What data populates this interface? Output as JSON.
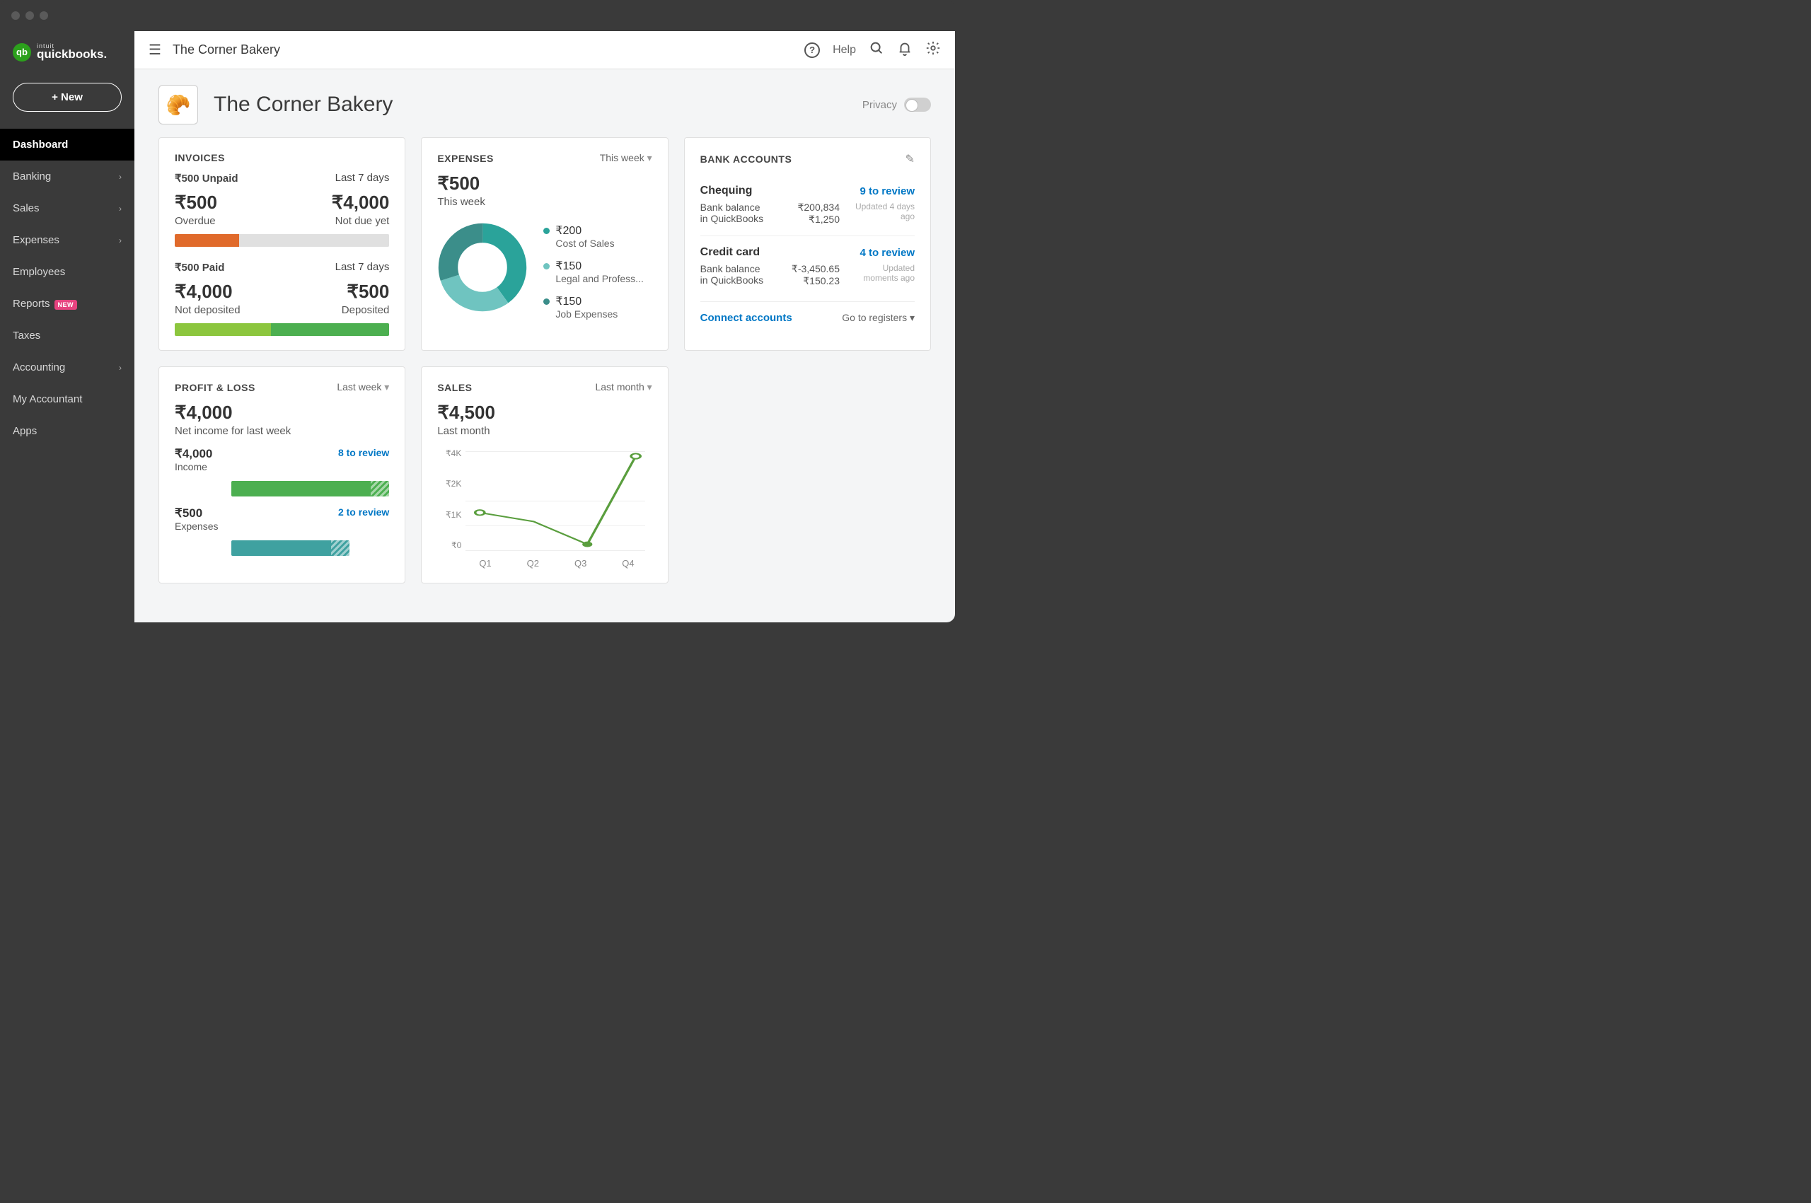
{
  "brand": {
    "badge": "qb",
    "top": "intuit",
    "name": "quickbooks."
  },
  "new_button": "+ New",
  "nav": [
    {
      "label": "Dashboard",
      "active": true,
      "chevron": false
    },
    {
      "label": "Banking",
      "chevron": true
    },
    {
      "label": "Sales",
      "chevron": true
    },
    {
      "label": "Expenses",
      "chevron": true
    },
    {
      "label": "Employees",
      "chevron": false
    },
    {
      "label": "Reports",
      "chevron": false,
      "badge": "NEW"
    },
    {
      "label": "Taxes",
      "chevron": false
    },
    {
      "label": "Accounting",
      "chevron": true
    },
    {
      "label": "My Accountant",
      "chevron": false
    },
    {
      "label": "Apps",
      "chevron": false
    }
  ],
  "topbar": {
    "title": "The Corner Bakery",
    "help": "Help"
  },
  "header": {
    "business_name": "The Corner Bakery",
    "privacy": "Privacy"
  },
  "invoices": {
    "title": "INVOICES",
    "unpaid_line": "₹500 Unpaid",
    "unpaid_period": "Last 7 days",
    "overdue_amt": "₹500",
    "overdue_lbl": "Overdue",
    "notdue_amt": "₹4,000",
    "notdue_lbl": "Not due yet",
    "paid_line": "₹500 Paid",
    "paid_period": "Last 7 days",
    "notdep_amt": "₹4,000",
    "notdep_lbl": "Not deposited",
    "dep_amt": "₹500",
    "dep_lbl": "Deposited",
    "colors": {
      "overdue": "#e06a2b",
      "grey": "#e0e0e0",
      "not_deposited": "#8cc63e",
      "deposited": "#4caf50"
    }
  },
  "expenses": {
    "title": "EXPENSES",
    "period": "This week",
    "total_amt": "₹500",
    "total_lbl": "This week",
    "items": [
      {
        "amt": "₹200",
        "label": "Cost of Sales",
        "color": "#2aa39a"
      },
      {
        "amt": "₹150",
        "label": "Legal and Profess...",
        "color": "#6fc4c0"
      },
      {
        "amt": "₹150",
        "label": "Job Expenses",
        "color": "#3b8e8a"
      }
    ]
  },
  "bank": {
    "title": "BANK ACCOUNTS",
    "accounts": [
      {
        "name": "Chequing",
        "review": "9 to review",
        "bal_lbl": "Bank balance",
        "bal": "₹200,834",
        "qb_lbl": "in QuickBooks",
        "qb": "₹1,250",
        "note": "Updated 4 days ago"
      },
      {
        "name": "Credit card",
        "review": "4 to review",
        "bal_lbl": "Bank balance",
        "bal": "₹-3,450.65",
        "qb_lbl": "in QuickBooks",
        "qb": "₹150.23",
        "note": "Updated moments ago"
      }
    ],
    "connect": "Connect accounts",
    "goto": "Go to registers"
  },
  "pl": {
    "title": "PROFIT & LOSS",
    "period": "Last week",
    "net_amt": "₹4,000",
    "net_lbl": "Net income for last week",
    "income_amt": "₹4,000",
    "income_lbl": "Income",
    "income_review": "8 to review",
    "expense_amt": "₹500",
    "expense_lbl": "Expenses",
    "expense_review": "2 to review"
  },
  "sales": {
    "title": "SALES",
    "period": "Last month",
    "total_amt": "₹4,500",
    "total_lbl": "Last month",
    "y_ticks": [
      "₹4K",
      "₹2K",
      "₹1K",
      "₹0"
    ],
    "x_ticks": [
      "Q1",
      "Q2",
      "Q3",
      "Q4"
    ]
  },
  "chart_data": [
    {
      "type": "pie",
      "title": "Expenses This week",
      "series": [
        {
          "name": "Cost of Sales",
          "value": 200
        },
        {
          "name": "Legal and Professional",
          "value": 150
        },
        {
          "name": "Job Expenses",
          "value": 150
        }
      ]
    },
    {
      "type": "line",
      "title": "Sales Last month",
      "categories": [
        "Q1",
        "Q2",
        "Q3",
        "Q4"
      ],
      "values": [
        1700,
        1300,
        250,
        4300
      ],
      "ylim": [
        0,
        4500
      ],
      "ylabel": "₹"
    }
  ]
}
